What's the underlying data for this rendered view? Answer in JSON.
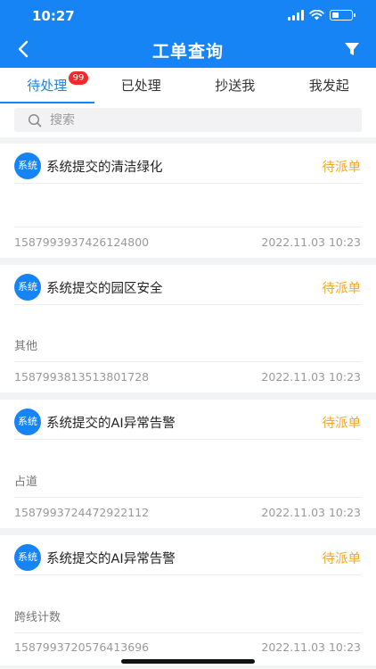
{
  "status_bar": {
    "time": "10:27"
  },
  "header": {
    "title": "工单查询"
  },
  "tabs": [
    {
      "label": "待处理",
      "badge": "99"
    },
    {
      "label": "已处理"
    },
    {
      "label": "抄送我"
    },
    {
      "label": "我发起"
    }
  ],
  "search": {
    "placeholder": "搜索"
  },
  "cards": [
    {
      "avatar": "系统",
      "title": "系统提交的清洁绿化",
      "status": "待派单",
      "desc": "",
      "id": "1587993937426124800",
      "time": "2022.11.03 10:23"
    },
    {
      "avatar": "系统",
      "title": "系统提交的园区安全",
      "status": "待派单",
      "desc": "其他",
      "id": "1587993813513801728",
      "time": "2022.11.03 10:23"
    },
    {
      "avatar": "系统",
      "title": "系统提交的AI异常告警",
      "status": "待派单",
      "desc": "占道",
      "id": "1587993724472922112",
      "time": "2022.11.03 10:23"
    },
    {
      "avatar": "系统",
      "title": "系统提交的AI异常告警",
      "status": "待派单",
      "desc": "跨线计数",
      "id": "1587993720576413696",
      "time": "2022.11.03 10:23"
    }
  ],
  "colors": {
    "primary": "#1784f5",
    "status_pending": "#f5a623",
    "badge": "#ef2a2a"
  }
}
